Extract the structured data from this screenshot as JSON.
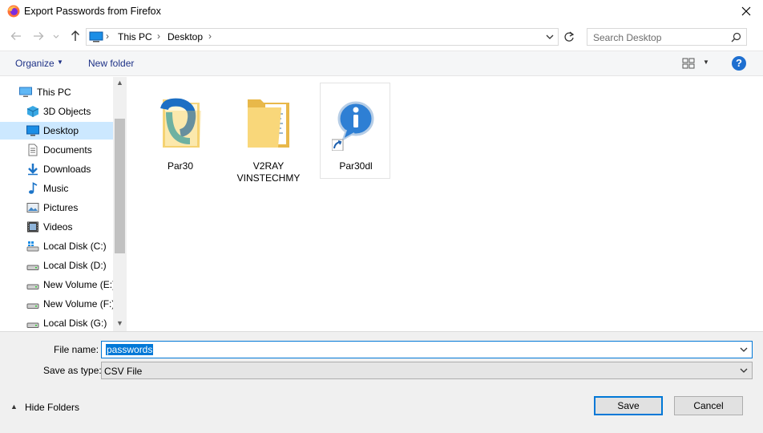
{
  "window": {
    "title": "Export Passwords from Firefox"
  },
  "address": {
    "crumbs": [
      "This PC",
      "Desktop"
    ]
  },
  "search": {
    "placeholder": "Search Desktop"
  },
  "toolbar": {
    "organize": "Organize",
    "new_folder": "New folder"
  },
  "sidebar": {
    "items": [
      {
        "label": "This PC",
        "icon": "pc-icon"
      },
      {
        "label": "3D Objects",
        "icon": "cube-icon"
      },
      {
        "label": "Desktop",
        "icon": "desktop-icon",
        "selected": true
      },
      {
        "label": "Documents",
        "icon": "document-icon"
      },
      {
        "label": "Downloads",
        "icon": "download-icon"
      },
      {
        "label": "Music",
        "icon": "music-icon"
      },
      {
        "label": "Pictures",
        "icon": "pictures-icon"
      },
      {
        "label": "Videos",
        "icon": "video-icon"
      },
      {
        "label": "Local Disk (C:)",
        "icon": "system-drive-icon"
      },
      {
        "label": "Local Disk (D:)",
        "icon": "drive-icon"
      },
      {
        "label": "New Volume (E:)",
        "icon": "drive-icon"
      },
      {
        "label": "New Volume (F:)",
        "icon": "drive-icon"
      },
      {
        "label": "Local Disk (G:)",
        "icon": "drive-icon"
      }
    ]
  },
  "files": [
    {
      "label_lines": [
        "Par30"
      ],
      "icon": "par30-folder-icon"
    },
    {
      "label_lines": [
        "V2RAY",
        "VINSTECHMY"
      ],
      "icon": "folder-icon"
    },
    {
      "label_lines": [
        "Par30dl"
      ],
      "icon": "info-shortcut-icon"
    }
  ],
  "form": {
    "file_name_label": "File name:",
    "file_name_value": "passwords",
    "save_type_label": "Save as type:",
    "save_type_value": "CSV File"
  },
  "footer": {
    "hide_folders": "Hide Folders",
    "save": "Save",
    "cancel": "Cancel"
  },
  "colors": {
    "accent": "#0078d7",
    "selected_bg": "#cce8ff",
    "link": "#1e3287"
  }
}
